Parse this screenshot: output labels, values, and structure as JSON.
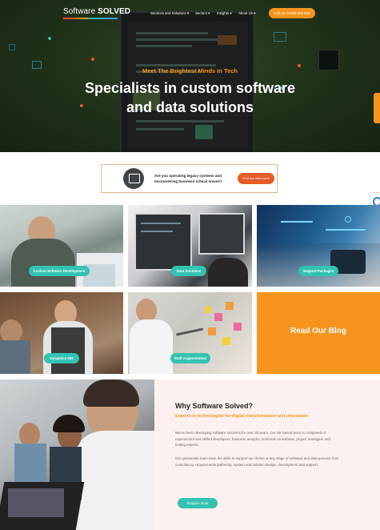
{
  "header": {
    "logo_regular": "Software ",
    "logo_bold": "SOLVED",
    "nav": [
      "Services and Solutions ▾",
      "Sectors ▾",
      "Insights ▾",
      "About Us ▾"
    ],
    "call_label": "Call us: 01993 883 544"
  },
  "hero": {
    "tagline": "Meet The Brightest Minds In Tech",
    "headline_line1": "Specialists in custom software",
    "headline_line2": "and data solutions"
  },
  "banner": {
    "icon": "computer-icon",
    "text": "Are you operating legacy systems and encountering business critical issues?",
    "button": "Find out more here"
  },
  "tiles": [
    {
      "label": "Custom Software Development"
    },
    {
      "label": "Data Solutions"
    },
    {
      "label": "Support Packages"
    },
    {
      "label": "Dynamics 365"
    },
    {
      "label": "Staff Augmentation"
    }
  ],
  "blog": {
    "label": "Read Our Blog"
  },
  "why": {
    "title": "Why Software Solved?",
    "subtitle": "Experts in technologies for digital transformation and innovation",
    "para1": "We've been developing software solutions for over 20 years. Our UK based team is comprised of experienced and skilled developers, business analysts, technical consultants, project managers and testing experts.",
    "para2": "Our passionate team have the skills to support our clients at any stage of software and data process from consultancy, requirements gathering, system and solution design, development and support.",
    "button": "Enquire Now"
  },
  "colors": {
    "accent_orange": "#f7941d",
    "teal": "#33c3b0",
    "hero_green": "#21331a",
    "why_bg": "#fdf1ef"
  }
}
